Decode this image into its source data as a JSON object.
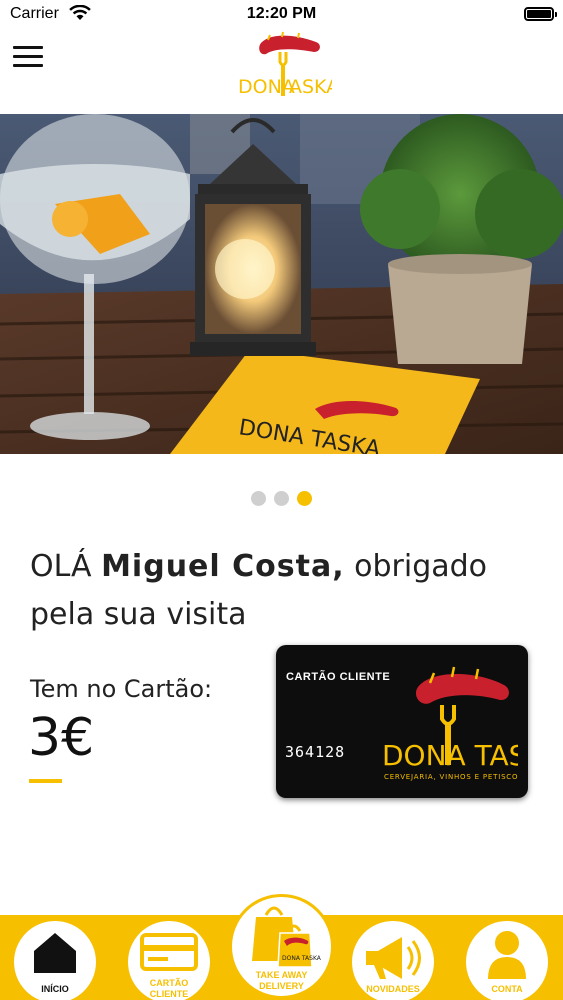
{
  "status_bar": {
    "carrier": "Carrier",
    "time": "12:20 PM"
  },
  "header": {
    "logo_text": "DONA TASKA"
  },
  "carousel": {
    "slide_count": 3,
    "active_index": 2
  },
  "greeting": {
    "prefix": "OLÁ ",
    "name": "Miguel Costa,",
    "suffix": " obrigado pela sua visita"
  },
  "card_summary": {
    "label": "Tem no Cartão:",
    "balance": "3€"
  },
  "loyalty_card": {
    "title": "CARTÃO CLIENTE",
    "number": "364128",
    "brand": "DONA TASKA",
    "tagline": "CERVEJARIA, VINHOS E PETISCOS"
  },
  "bottom_nav": {
    "items": [
      {
        "label_line1": "INÍCIO",
        "label_line2": "",
        "icon": "home-icon"
      },
      {
        "label_line1": "CARTÃO",
        "label_line2": "CLIENTE",
        "icon": "card-icon"
      },
      {
        "label_line1": "TAKE AWAY",
        "label_line2": "DELIVERY",
        "icon": "shopping-bag-icon"
      },
      {
        "label_line1": "NOVIDADES",
        "label_line2": "",
        "icon": "megaphone-icon"
      },
      {
        "label_line1": "CONTA",
        "label_line2": "",
        "icon": "user-icon"
      }
    ]
  },
  "colors": {
    "accent": "#f6bf00",
    "brand_red": "#c8202d",
    "text": "#222222",
    "card_bg": "#0d0d0d"
  }
}
